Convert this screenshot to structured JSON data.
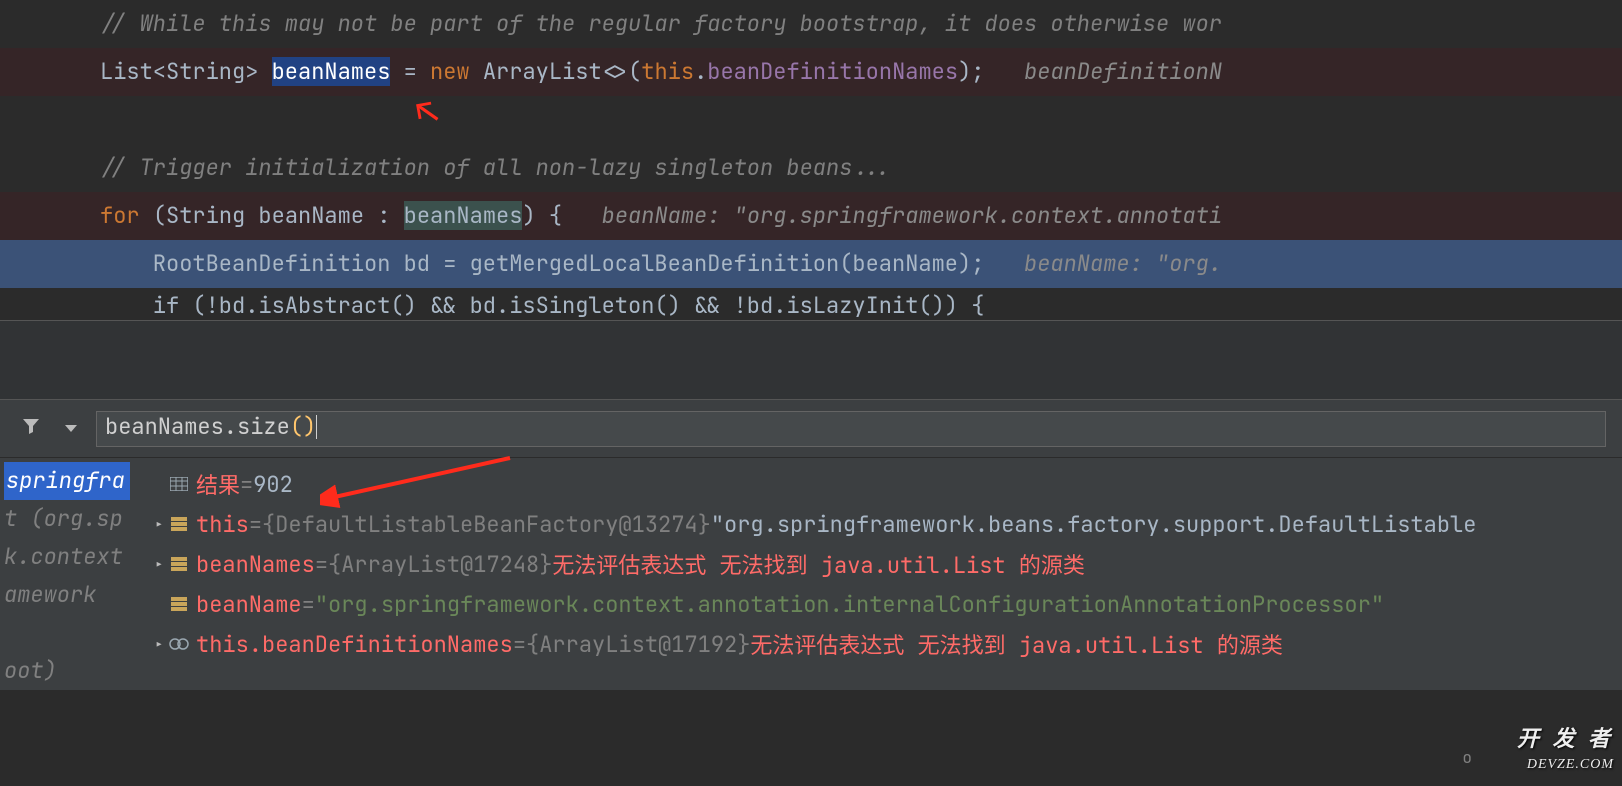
{
  "code": {
    "l1_comment": "// While this may not be part of the regular factory bootstrap, it does otherwise wor",
    "l2_a": "List<String> ",
    "l2_hl": "beanNames",
    "l2_b": " = ",
    "l2_new": "new",
    "l2_c": " ArrayList<>(",
    "l2_this": "this",
    "l2_dot": ".",
    "l2_field": "beanDefinitionNames",
    "l2_end": ");",
    "l2_hint": "   beanDefinitionN",
    "l3_comment": "// Trigger initialization of all non-lazy singleton beans...",
    "l4_for": "for ",
    "l4_a": "(String beanName : ",
    "l4_hl": "beanNames",
    "l4_b": ") {",
    "l4_hint": "   beanName: \"org.springframework.context.annotati",
    "l5_a": "    RootBeanDefinition bd = getMergedLocalBeanDefinition(beanName);",
    "l5_hint": "   beanName: \"org.",
    "l6": "    if (!bd.isAbstract() && bd.isSingleton() && !bd.isLazyInit()) {"
  },
  "expr": {
    "value_a": "beanNames.size",
    "value_b": "()"
  },
  "frames": {
    "f0": "springfra",
    "f1": "t (org.sp",
    "f2": "k.context",
    "f3": "amework",
    "f4": "oot)"
  },
  "vars": {
    "result_label": "结果",
    "result_eq": " = ",
    "result_val": "902",
    "this_name": "this",
    "this_eq": " = ",
    "this_type": "{DefaultListableBeanFactory@13274} ",
    "this_str": "\"org.springframework.beans.factory.support.DefaultListable",
    "bn_name": "beanNames",
    "bn_eq": " = ",
    "bn_type": "{ArrayList@17248} ",
    "bn_err": "无法评估表达式 无法找到 java.util.List 的源类",
    "bN_name": "beanName",
    "bN_eq": " = ",
    "bN_val": "\"org.springframework.context.annotation.internalConfigurationAnnotationProcessor\"",
    "bdef_name": "this.beanDefinitionNames",
    "bdef_eq": " = ",
    "bdef_type": "{ArrayList@17192} ",
    "bdef_err": "无法评估表达式 无法找到 java.util.List 的源类"
  },
  "watermark": {
    "l1": "开 发 者",
    "l2": "DEVZE.COM"
  },
  "status_char": "o"
}
